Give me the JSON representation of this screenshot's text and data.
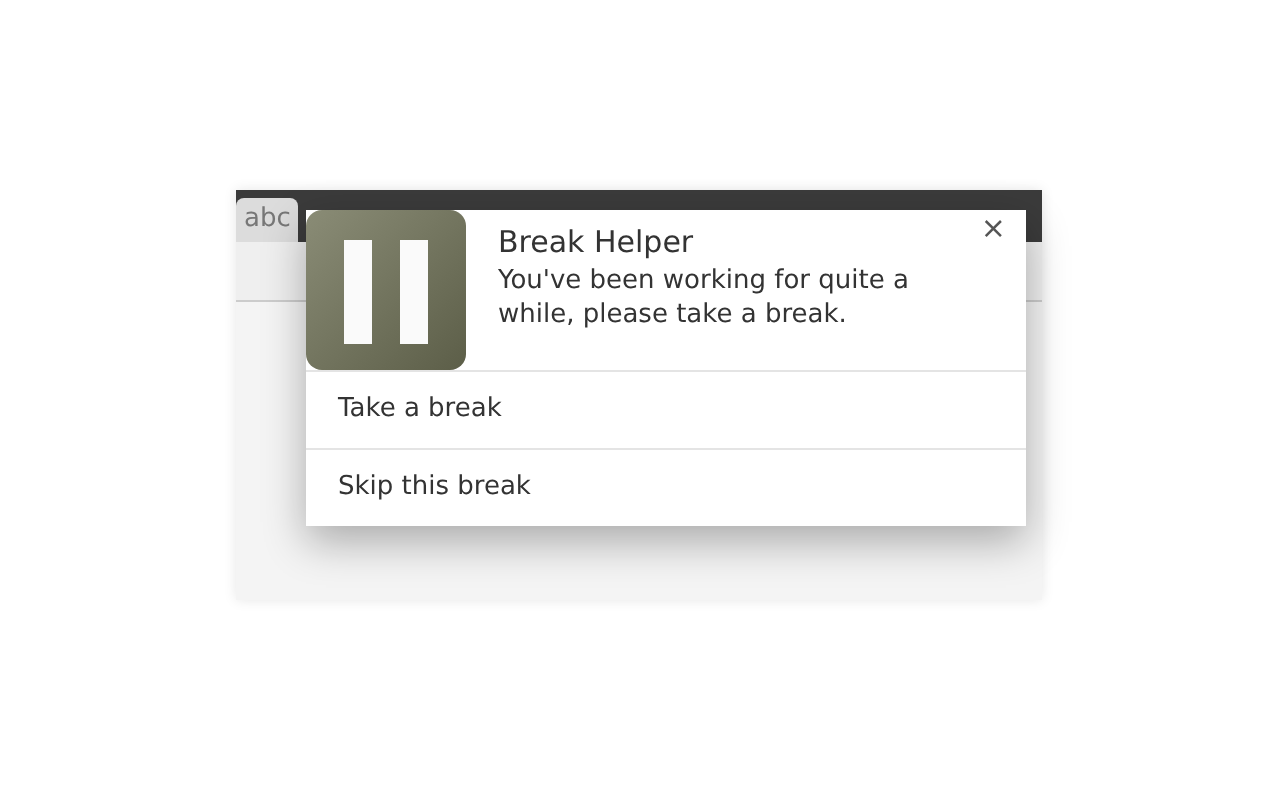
{
  "background_window": {
    "tab_label": "abc"
  },
  "notification": {
    "title": "Break Helper",
    "message": "You've been working for quite a while, please take a break.",
    "close": "×",
    "actions": [
      {
        "label": "Take a break"
      },
      {
        "label": "Skip this break"
      }
    ]
  }
}
